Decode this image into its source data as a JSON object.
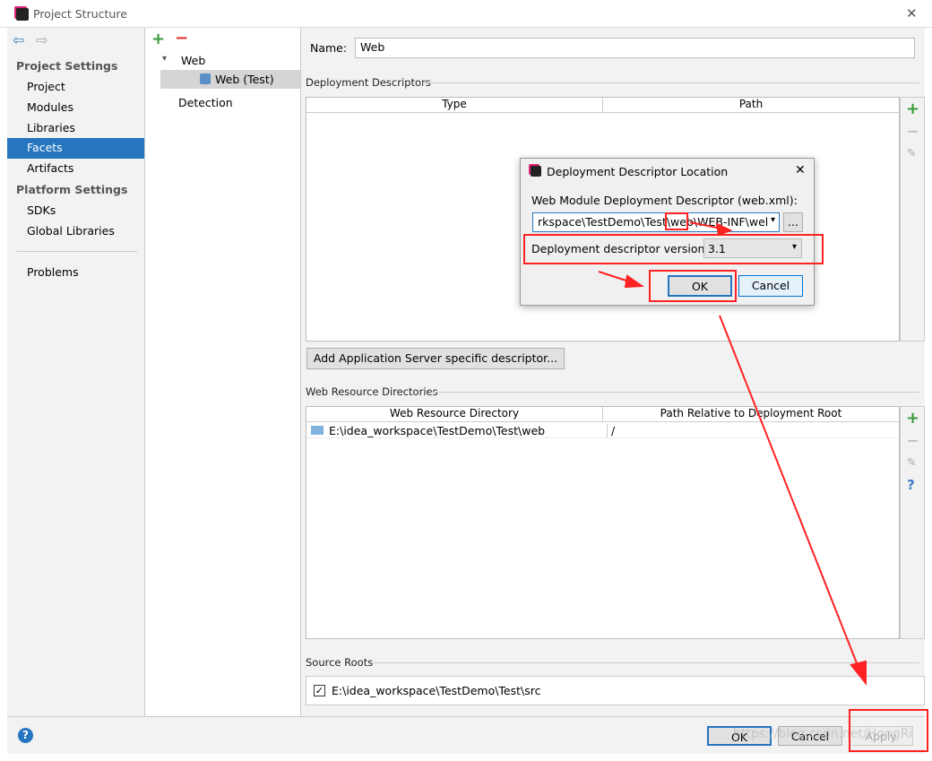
{
  "window": {
    "title": "Project Structure",
    "close": "✕"
  },
  "nav": {
    "back": "⇦",
    "forward": "⇨"
  },
  "sidebar": {
    "project_settings": "Project Settings",
    "items": [
      {
        "label": "Project"
      },
      {
        "label": "Modules"
      },
      {
        "label": "Libraries"
      },
      {
        "label": "Facets",
        "selected": true
      },
      {
        "label": "Artifacts"
      }
    ],
    "platform_settings": "Platform Settings",
    "platform_items": [
      {
        "label": "SDKs"
      },
      {
        "label": "Global Libraries"
      }
    ],
    "problems": "Problems"
  },
  "tree": {
    "add": "+",
    "remove": "−",
    "root": "Web",
    "child": "Web (Test)",
    "detection": "Detection"
  },
  "main": {
    "name_label": "Name:",
    "name_value": "Web",
    "deployment_descriptors": "Deployment Descriptors",
    "dd_columns": [
      "Type",
      "Path"
    ],
    "add_server_descriptor": "Add Application Server specific descriptor...",
    "web_resource_dirs": "Web Resource Directories",
    "wr_columns": [
      "Web Resource Directory",
      "Path Relative to Deployment Root"
    ],
    "wr_rows": [
      {
        "dir": "E:\\idea_workspace\\TestDemo\\Test\\web",
        "path": "/"
      }
    ],
    "source_roots": "Source Roots",
    "source_root": {
      "checked": true,
      "path": "E:\\idea_workspace\\TestDemo\\Test\\src"
    }
  },
  "dialog": {
    "title": "Deployment Descriptor Location",
    "close": "✕",
    "descriptor_label": "Web Module Deployment Descriptor (web.xml):",
    "descriptor_value": "rkspace\\TestDemo\\Test\\web\\WEB-INF\\wel",
    "browse": "...",
    "version_label": "Deployment descriptor version",
    "version_value": "3.1",
    "ok": "OK",
    "cancel": "Cancel"
  },
  "footer": {
    "help": "?",
    "ok": "OK",
    "cancel": "Cancel",
    "apply": "Apply"
  },
  "watermark": "https://blog.csdn.net/HongRi",
  "colors": {
    "selection": "#2675bf",
    "annotation": "#ff2222",
    "add": "#3a9a3a"
  }
}
